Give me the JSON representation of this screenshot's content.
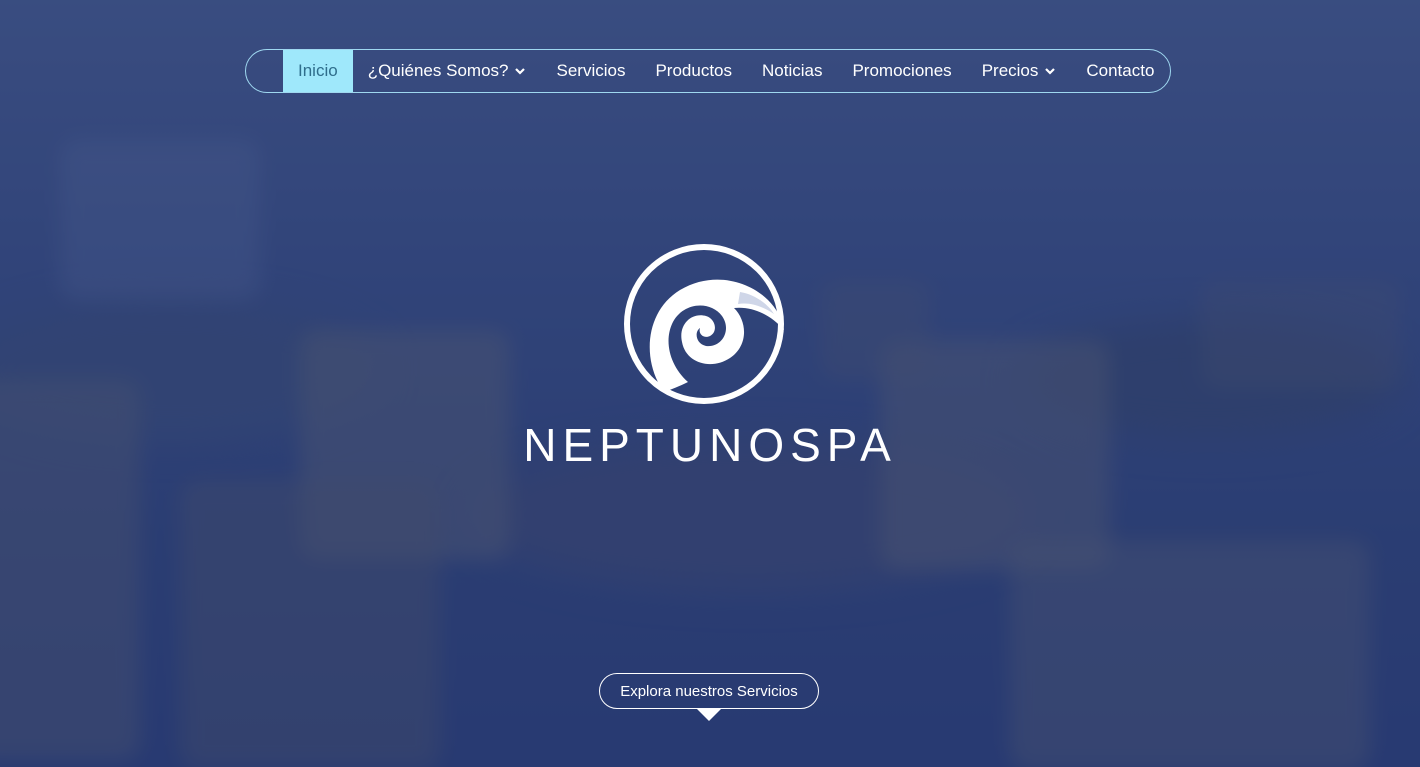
{
  "nav": {
    "items": [
      {
        "label": "Inicio",
        "active": true,
        "dropdown": false
      },
      {
        "label": "¿Quiénes Somos?",
        "active": false,
        "dropdown": true
      },
      {
        "label": "Servicios",
        "active": false,
        "dropdown": false
      },
      {
        "label": "Productos",
        "active": false,
        "dropdown": false
      },
      {
        "label": "Noticias",
        "active": false,
        "dropdown": false
      },
      {
        "label": "Promociones",
        "active": false,
        "dropdown": false
      },
      {
        "label": "Precios",
        "active": false,
        "dropdown": true
      },
      {
        "label": "Contacto",
        "active": false,
        "dropdown": false
      }
    ]
  },
  "hero": {
    "brand": "NEPTUNOSPA",
    "logo_icon": "wave-circle-logo",
    "cta_label": "Explora nuestros Servicios"
  },
  "colors": {
    "accent": "#9fe8fb",
    "nav_border": "#9fd8f0",
    "overlay": "#2a3e78",
    "text": "#ffffff"
  }
}
